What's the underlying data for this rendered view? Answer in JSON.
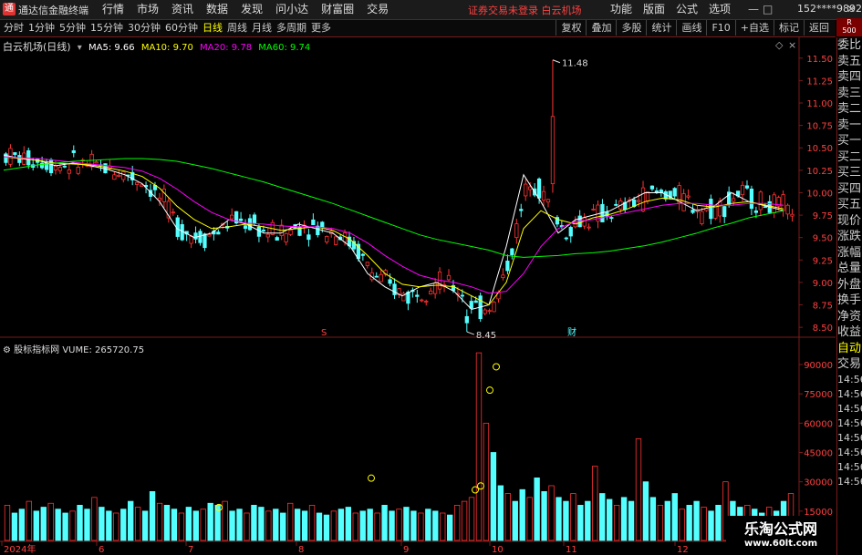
{
  "titlebar": {
    "app_name": "通达信金融终端",
    "menu": [
      "行情",
      "市场",
      "资讯",
      "数据",
      "发现",
      "问小达",
      "财富圈",
      "交易"
    ],
    "alert": "证券交易未登录  白云机场",
    "right_menu": [
      "功能",
      "版面",
      "公式",
      "选项"
    ],
    "user": "152****9892"
  },
  "toolbar": {
    "periods": [
      "分时",
      "1分钟",
      "5分钟",
      "15分钟",
      "30分钟",
      "60分钟",
      "日线",
      "周线",
      "月线",
      "多周期",
      "更多"
    ],
    "active_period": "日线",
    "tools": [
      "复权",
      "叠加",
      "多股",
      "统计",
      "画线",
      "F10",
      "+自选",
      "标记",
      "返回"
    ]
  },
  "right_tab": "R\n500",
  "stock": {
    "title": "白云机场(日线)",
    "ma5_label": "MA5: 9.66",
    "ma10_label": "MA10: 9.70",
    "ma20_label": "MA20: 9.78",
    "ma60_label": "MA60: 9.74"
  },
  "volume": {
    "indicator": "股标指标网",
    "label": "VUME: 265720.75"
  },
  "right_panel": {
    "items": [
      "委比",
      "卖五",
      "卖四",
      "卖三",
      "卖二",
      "卖一",
      "买一",
      "买二",
      "买三",
      "买四",
      "买五",
      "现价",
      "涨跌",
      "涨幅",
      "总量",
      "外盘",
      "换手",
      "净资",
      "收益"
    ],
    "auto": "自动",
    "trade": "交易",
    "times": [
      "14:56",
      "14:56",
      "14:56",
      "14:56",
      "14:56",
      "14:56",
      "14:56",
      "14:56"
    ]
  },
  "markers": {
    "high": "11.48",
    "low": "8.45",
    "s_mark": "S",
    "cai": "财"
  },
  "colors": {
    "up": "#ff3232",
    "down": "#54ffff",
    "ma5": "#ffffff",
    "ma10": "#ffff00",
    "ma20": "#ff00ff",
    "ma60": "#00ff00"
  },
  "watermark": {
    "line1": "乐淘公式网",
    "line2": "www.60lt.com"
  },
  "chart_data": [
    {
      "type": "candlestick",
      "title": "白云机场(日线)",
      "y_ticks": [
        11.5,
        11.25,
        11.0,
        10.75,
        10.5,
        10.25,
        10.0,
        9.75,
        9.5,
        9.25,
        9.0,
        8.75,
        8.5
      ],
      "ylim": [
        8.4,
        11.65
      ],
      "x_labels": [
        "2024年",
        "6",
        "7",
        "8",
        "9",
        "10",
        "11",
        "12"
      ],
      "series": [
        {
          "name": "MA5",
          "values": [
            10.42,
            10.38,
            10.36,
            10.3,
            10.33,
            10.3,
            10.26,
            10.2,
            10.1,
            9.9,
            9.6,
            9.5,
            9.55,
            9.7,
            9.65,
            9.55,
            9.55,
            9.65,
            9.6,
            9.55,
            9.4,
            9.1,
            8.95,
            8.85,
            8.95,
            9.0,
            8.9,
            8.7,
            8.75,
            9.4,
            10.2,
            9.9,
            9.55,
            9.7,
            9.75,
            9.8,
            9.9,
            10.0,
            10.0,
            9.9,
            9.8,
            9.85,
            10.0,
            9.9,
            9.85,
            9.8
          ]
        },
        {
          "name": "MA10",
          "values": [
            10.4,
            10.38,
            10.36,
            10.33,
            10.32,
            10.31,
            10.28,
            10.24,
            10.18,
            10.05,
            9.85,
            9.7,
            9.6,
            9.62,
            9.65,
            9.62,
            9.58,
            9.6,
            9.62,
            9.58,
            9.48,
            9.3,
            9.1,
            8.98,
            8.95,
            8.97,
            8.95,
            8.85,
            8.75,
            9.0,
            9.6,
            9.8,
            9.7,
            9.65,
            9.72,
            9.76,
            9.82,
            9.9,
            9.94,
            9.92,
            9.86,
            9.84,
            9.88,
            9.9,
            9.86,
            9.82
          ]
        },
        {
          "name": "MA20",
          "values": [
            10.4,
            10.39,
            10.38,
            10.36,
            10.34,
            10.32,
            10.3,
            10.28,
            10.24,
            10.16,
            10.04,
            9.9,
            9.78,
            9.7,
            9.66,
            9.65,
            9.63,
            9.62,
            9.62,
            9.6,
            9.55,
            9.44,
            9.3,
            9.18,
            9.08,
            9.03,
            9.0,
            8.95,
            8.88,
            8.9,
            9.1,
            9.4,
            9.6,
            9.68,
            9.7,
            9.74,
            9.78,
            9.82,
            9.86,
            9.88,
            9.88,
            9.86,
            9.86,
            9.88,
            9.88,
            9.86
          ]
        },
        {
          "name": "MA60",
          "values": [
            10.25,
            10.28,
            10.31,
            10.33,
            10.35,
            10.36,
            10.37,
            10.38,
            10.38,
            10.37,
            10.35,
            10.31,
            10.27,
            10.22,
            10.17,
            10.12,
            10.06,
            10.0,
            9.94,
            9.88,
            9.81,
            9.74,
            9.67,
            9.6,
            9.53,
            9.48,
            9.44,
            9.4,
            9.36,
            9.3,
            9.28,
            9.29,
            9.3,
            9.32,
            9.33,
            9.35,
            9.38,
            9.41,
            9.45,
            9.5,
            9.55,
            9.61,
            9.66,
            9.72,
            9.76,
            9.8
          ]
        }
      ],
      "highest": 11.48,
      "lowest": 8.45
    },
    {
      "type": "bar",
      "title": "VUME",
      "y_ticks": [
        90000,
        75000,
        60000,
        45000,
        30000,
        15000
      ],
      "ylim": [
        0,
        97000
      ],
      "values": [
        18000,
        14000,
        16000,
        20000,
        15000,
        17000,
        19000,
        16000,
        14000,
        15000,
        18000,
        16000,
        22000,
        17000,
        15000,
        14000,
        16000,
        20000,
        17000,
        15000,
        25000,
        19000,
        18000,
        16000,
        14000,
        17000,
        15000,
        16000,
        19000,
        18000,
        20000,
        15000,
        16000,
        14000,
        18000,
        17000,
        15000,
        16000,
        14000,
        19000,
        16000,
        15000,
        18000,
        14000,
        13000,
        15000,
        16000,
        17000,
        14000,
        15000,
        16000,
        14000,
        18000,
        15000,
        16000,
        17000,
        15000,
        14000,
        16000,
        15000,
        14000,
        13000,
        18000,
        20000,
        22000,
        96000,
        60000,
        45000,
        28000,
        24000,
        20000,
        26000,
        22000,
        32000,
        25000,
        28000,
        22000,
        20000,
        24000,
        18000,
        20000,
        38000,
        24000,
        21000,
        18000,
        22000,
        20000,
        52000,
        30000,
        22000,
        18000,
        20000,
        24000,
        16000,
        18000,
        20000,
        17000,
        15000,
        18000,
        30000,
        20000,
        17000,
        18000,
        16000,
        14000,
        17000,
        15000,
        20000,
        24000
      ]
    }
  ]
}
